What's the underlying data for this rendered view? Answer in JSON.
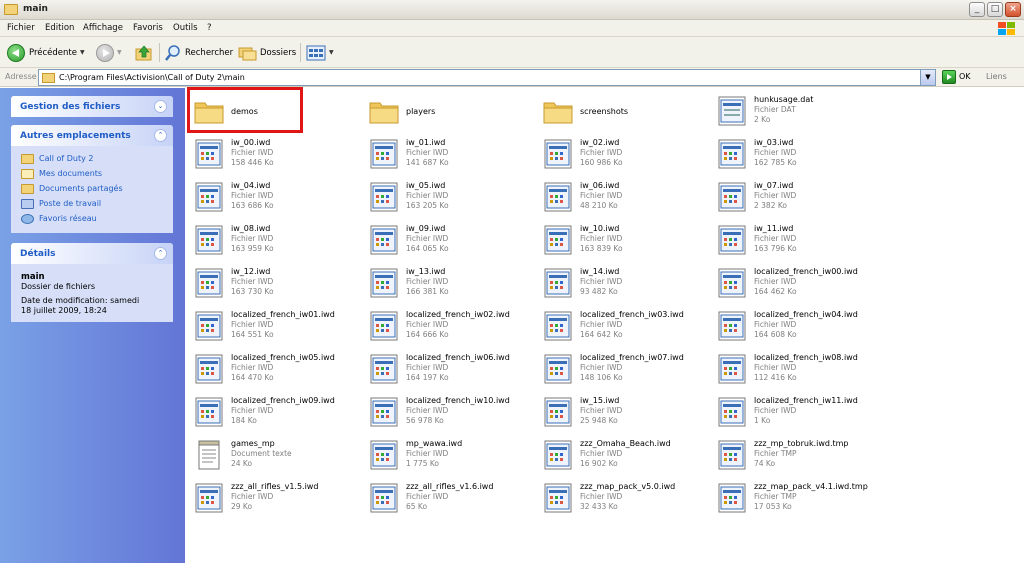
{
  "window": {
    "title": "main"
  },
  "menu": [
    "Fichier",
    "Edition",
    "Affichage",
    "Favoris",
    "Outils",
    "?"
  ],
  "toolbar": {
    "back_label": "Précédente",
    "search_label": "Rechercher",
    "folders_label": "Dossiers"
  },
  "address": {
    "label": "Adresse",
    "path": "C:\\Program Files\\Activision\\Call of Duty 2\\main",
    "go_label": "OK",
    "links_label": "Liens"
  },
  "sidebar": {
    "file_tasks": {
      "title": "Gestion des fichiers"
    },
    "other_places": {
      "title": "Autres emplacements",
      "items": [
        "Call of Duty 2",
        "Mes documents",
        "Documents partagés",
        "Poste de travail",
        "Favoris réseau"
      ]
    },
    "details": {
      "title": "Détails",
      "name": "main",
      "type": "Dossier de fichiers",
      "modified": "Date de modification: samedi 18 juillet 2009, 18:24"
    }
  },
  "colors": {
    "highlight": "#e01616",
    "sidebar_link": "#215dc6"
  },
  "files": [
    {
      "name": "demos",
      "kind": "folder",
      "type": "",
      "size": ""
    },
    {
      "name": "players",
      "kind": "folder",
      "type": "",
      "size": ""
    },
    {
      "name": "screenshots",
      "kind": "folder",
      "type": "",
      "size": ""
    },
    {
      "name": "hunkusage.dat",
      "kind": "file",
      "type": "Fichier DAT",
      "size": "2 Ko"
    },
    {
      "name": "iw_00.iwd",
      "kind": "iwd",
      "type": "Fichier IWD",
      "size": "158 446 Ko"
    },
    {
      "name": "iw_01.iwd",
      "kind": "iwd",
      "type": "Fichier IWD",
      "size": "141 687 Ko"
    },
    {
      "name": "iw_02.iwd",
      "kind": "iwd",
      "type": "Fichier IWD",
      "size": "160 986 Ko"
    },
    {
      "name": "iw_03.iwd",
      "kind": "iwd",
      "type": "Fichier IWD",
      "size": "162 785 Ko"
    },
    {
      "name": "iw_04.iwd",
      "kind": "iwd",
      "type": "Fichier IWD",
      "size": "163 686 Ko"
    },
    {
      "name": "iw_05.iwd",
      "kind": "iwd",
      "type": "Fichier IWD",
      "size": "163 205 Ko"
    },
    {
      "name": "iw_06.iwd",
      "kind": "iwd",
      "type": "Fichier IWD",
      "size": "48 210 Ko"
    },
    {
      "name": "iw_07.iwd",
      "kind": "iwd",
      "type": "Fichier IWD",
      "size": "2 382 Ko"
    },
    {
      "name": "iw_08.iwd",
      "kind": "iwd",
      "type": "Fichier IWD",
      "size": "163 959 Ko"
    },
    {
      "name": "iw_09.iwd",
      "kind": "iwd",
      "type": "Fichier IWD",
      "size": "164 065 Ko"
    },
    {
      "name": "iw_10.iwd",
      "kind": "iwd",
      "type": "Fichier IWD",
      "size": "163 839 Ko"
    },
    {
      "name": "iw_11.iwd",
      "kind": "iwd",
      "type": "Fichier IWD",
      "size": "163 796 Ko"
    },
    {
      "name": "iw_12.iwd",
      "kind": "iwd",
      "type": "Fichier IWD",
      "size": "163 730 Ko"
    },
    {
      "name": "iw_13.iwd",
      "kind": "iwd",
      "type": "Fichier IWD",
      "size": "166 381 Ko"
    },
    {
      "name": "iw_14.iwd",
      "kind": "iwd",
      "type": "Fichier IWD",
      "size": "93 482 Ko"
    },
    {
      "name": "localized_french_iw00.iwd",
      "kind": "iwd",
      "type": "Fichier IWD",
      "size": "164 462 Ko"
    },
    {
      "name": "localized_french_iw01.iwd",
      "kind": "iwd",
      "type": "Fichier IWD",
      "size": "164 551 Ko"
    },
    {
      "name": "localized_french_iw02.iwd",
      "kind": "iwd",
      "type": "Fichier IWD",
      "size": "164 666 Ko"
    },
    {
      "name": "localized_french_iw03.iwd",
      "kind": "iwd",
      "type": "Fichier IWD",
      "size": "164 642 Ko"
    },
    {
      "name": "localized_french_iw04.iwd",
      "kind": "iwd",
      "type": "Fichier IWD",
      "size": "164 608 Ko"
    },
    {
      "name": "localized_french_iw05.iwd",
      "kind": "iwd",
      "type": "Fichier IWD",
      "size": "164 470 Ko"
    },
    {
      "name": "localized_french_iw06.iwd",
      "kind": "iwd",
      "type": "Fichier IWD",
      "size": "164 197 Ko"
    },
    {
      "name": "localized_french_iw07.iwd",
      "kind": "iwd",
      "type": "Fichier IWD",
      "size": "148 106 Ko"
    },
    {
      "name": "localized_french_iw08.iwd",
      "kind": "iwd",
      "type": "Fichier IWD",
      "size": "112 416 Ko"
    },
    {
      "name": "localized_french_iw09.iwd",
      "kind": "iwd",
      "type": "Fichier IWD",
      "size": "184 Ko"
    },
    {
      "name": "localized_french_iw10.iwd",
      "kind": "iwd",
      "type": "Fichier IWD",
      "size": "56 978 Ko"
    },
    {
      "name": "iw_15.iwd",
      "kind": "iwd",
      "type": "Fichier IWD",
      "size": "25 948 Ko"
    },
    {
      "name": "localized_french_iw11.iwd",
      "kind": "iwd",
      "type": "Fichier IWD",
      "size": "1 Ko"
    },
    {
      "name": "games_mp",
      "kind": "text",
      "type": "Document texte",
      "size": "24 Ko"
    },
    {
      "name": "mp_wawa.iwd",
      "kind": "iwd",
      "type": "Fichier IWD",
      "size": "1 775 Ko"
    },
    {
      "name": "zzz_Omaha_Beach.iwd",
      "kind": "iwd",
      "type": "Fichier IWD",
      "size": "16 902 Ko"
    },
    {
      "name": "zzz_mp_tobruk.iwd.tmp",
      "kind": "iwd",
      "type": "Fichier TMP",
      "size": "74 Ko"
    },
    {
      "name": "zzz_all_rifles_v1.5.iwd",
      "kind": "iwd",
      "type": "Fichier IWD",
      "size": "29 Ko"
    },
    {
      "name": "zzz_all_rifles_v1.6.iwd",
      "kind": "iwd",
      "type": "Fichier IWD",
      "size": "65 Ko"
    },
    {
      "name": "zzz_map_pack_v5.0.iwd",
      "kind": "iwd",
      "type": "Fichier IWD",
      "size": "32 433 Ko"
    },
    {
      "name": "zzz_map_pack_v4.1.iwd.tmp",
      "kind": "iwd",
      "type": "Fichier TMP",
      "size": "17 053 Ko"
    }
  ]
}
